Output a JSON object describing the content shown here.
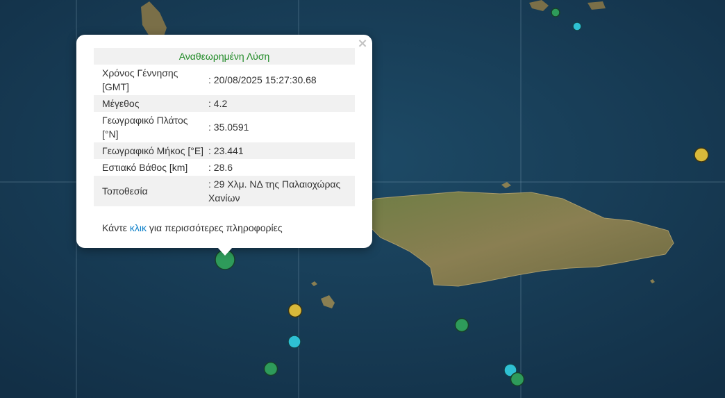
{
  "popup": {
    "title": "Αναθεωρημένη Λύση",
    "close_symbol": "×",
    "rows": [
      {
        "label": "Χρόνος Γέννησης [GMT]",
        "value": ": 20/08/2025 15:27:30.68"
      },
      {
        "label": "Μέγεθος",
        "value": ": 4.2"
      },
      {
        "label": "Γεωγραφικό Πλάτος [°N]",
        "value": ": 35.0591"
      },
      {
        "label": "Γεωγραφικό Μήκος [°E]",
        "value": ": 23.441"
      },
      {
        "label": "Εστιακό Βάθος [km]",
        "value": ": 28.6"
      },
      {
        "label": "Τοποθεσία",
        "value": ": 29 Χλμ. ΝΔ της Παλαιοχώρας Χανίων"
      }
    ],
    "more_before": "Κάντε ",
    "more_link": "κλικ",
    "more_after": " για περισσότερες πληροφορίες"
  },
  "colors": {
    "sea": "#163a55",
    "land": "#7d7a4a",
    "marker_green": "#2e9b5a",
    "marker_yellow": "#d9b93a",
    "marker_cyan": "#2ec0d3",
    "title_green": "#1f8a25",
    "link_blue": "#0a7ec8"
  },
  "markers_legend": [
    "green-event-marker",
    "yellow-event-marker",
    "cyan-event-marker"
  ]
}
